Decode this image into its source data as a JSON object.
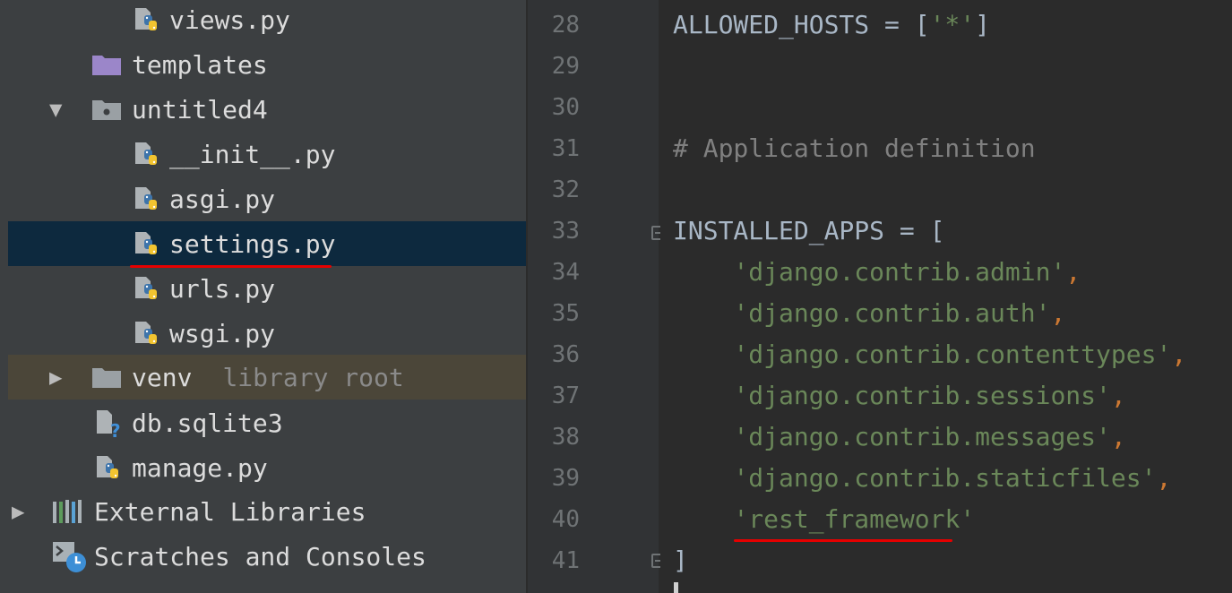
{
  "project_tree": {
    "items": [
      {
        "label": "views.py",
        "hint": ""
      },
      {
        "label": "templates",
        "hint": ""
      },
      {
        "label": "untitled4",
        "hint": ""
      },
      {
        "label": "__init__.py",
        "hint": ""
      },
      {
        "label": "asgi.py",
        "hint": ""
      },
      {
        "label": "settings.py",
        "hint": ""
      },
      {
        "label": "urls.py",
        "hint": ""
      },
      {
        "label": "wsgi.py",
        "hint": ""
      },
      {
        "label": "venv",
        "hint": "library root"
      },
      {
        "label": "db.sqlite3",
        "hint": ""
      },
      {
        "label": "manage.py",
        "hint": ""
      },
      {
        "label": "External Libraries",
        "hint": ""
      },
      {
        "label": "Scratches and Consoles",
        "hint": ""
      }
    ]
  },
  "editor": {
    "line_numbers": [
      "28",
      "29",
      "30",
      "31",
      "32",
      "33",
      "34",
      "35",
      "36",
      "37",
      "38",
      "39",
      "40",
      "41"
    ],
    "lines": [
      {
        "a": "ALLOWED_HOSTS = [",
        "s": "'*'",
        "b": "]",
        "c": ""
      },
      {
        "a": "",
        "s": "",
        "b": "",
        "c": ""
      },
      {
        "a": "",
        "s": "",
        "b": "",
        "c": ""
      },
      {
        "a": "",
        "s": "",
        "b": "",
        "c": "# Application definition"
      },
      {
        "a": "",
        "s": "",
        "b": "",
        "c": ""
      },
      {
        "a": "INSTALLED_APPS = [",
        "s": "",
        "b": "",
        "c": ""
      },
      {
        "a": "    ",
        "s": "'django.contrib.admin'",
        "b": ",",
        "c": ""
      },
      {
        "a": "    ",
        "s": "'django.contrib.auth'",
        "b": ",",
        "c": ""
      },
      {
        "a": "    ",
        "s": "'django.contrib.contenttypes'",
        "b": ",",
        "c": ""
      },
      {
        "a": "    ",
        "s": "'django.contrib.sessions'",
        "b": ",",
        "c": ""
      },
      {
        "a": "    ",
        "s": "'django.contrib.messages'",
        "b": ",",
        "c": ""
      },
      {
        "a": "    ",
        "s": "'django.contrib.staticfiles'",
        "b": ",",
        "c": ""
      },
      {
        "a": "    ",
        "s": "'rest_framework'",
        "b": "",
        "c": ""
      },
      {
        "a": "]",
        "s": "",
        "b": "",
        "c": ""
      }
    ]
  },
  "colors": {
    "tree_bg": "#3c3f41",
    "selection": "#0d293e",
    "excluded_bg": "#4b4639",
    "editor_bg": "#2b2b2b",
    "string": "#6a8759",
    "comment": "#808080",
    "punctuation": "#cc7832",
    "annotation_underline": "#e50000"
  }
}
